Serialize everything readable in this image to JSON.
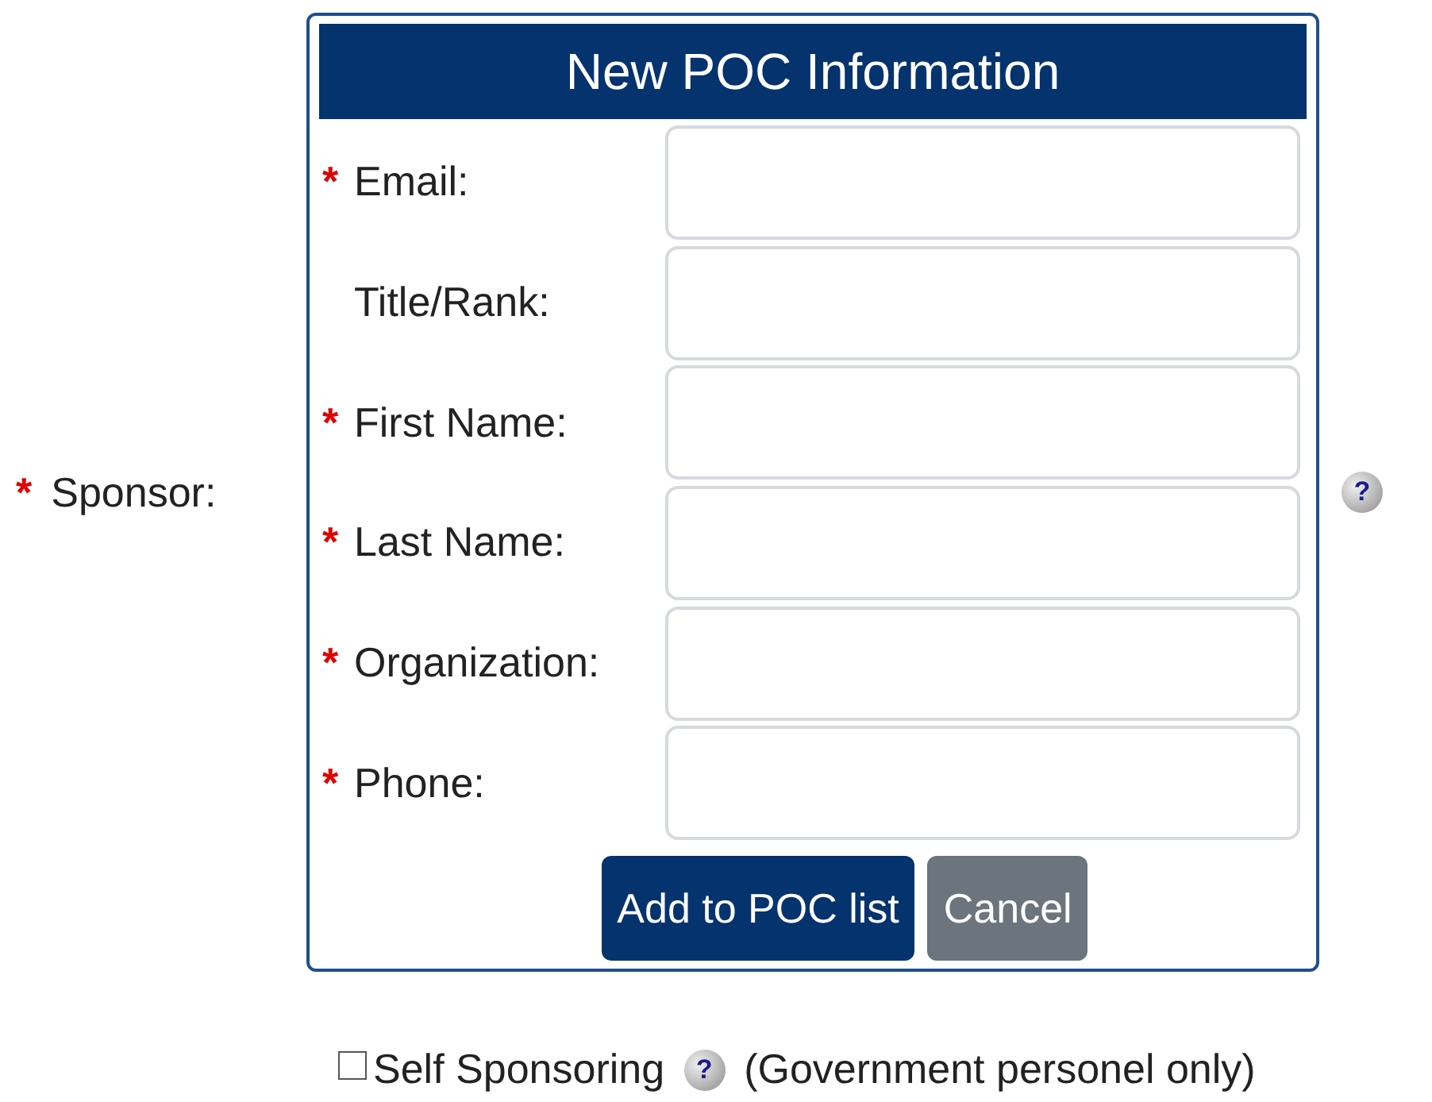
{
  "sponsor": {
    "mark": "*",
    "label": "Sponsor:",
    "help": "?"
  },
  "poc_panel": {
    "title": "New POC Information",
    "fields": [
      {
        "mark": "*",
        "label": "Email:"
      },
      {
        "label": "Title/Rank:"
      },
      {
        "mark": "*",
        "label": "First Name:"
      },
      {
        "mark": "*",
        "label": "Last Name:"
      },
      {
        "mark": "*",
        "label": "Organization:"
      },
      {
        "mark": "*",
        "label": "Phone:"
      }
    ],
    "buttons": [
      {
        "label": "Add to POC list",
        "kind": "primary"
      },
      {
        "label": "Cancel",
        "kind": "secondary"
      }
    ]
  },
  "self_sponsoring": {
    "checked": false,
    "label": "Self Sponsoring",
    "help": "?",
    "note": "(Government personel only)"
  }
}
